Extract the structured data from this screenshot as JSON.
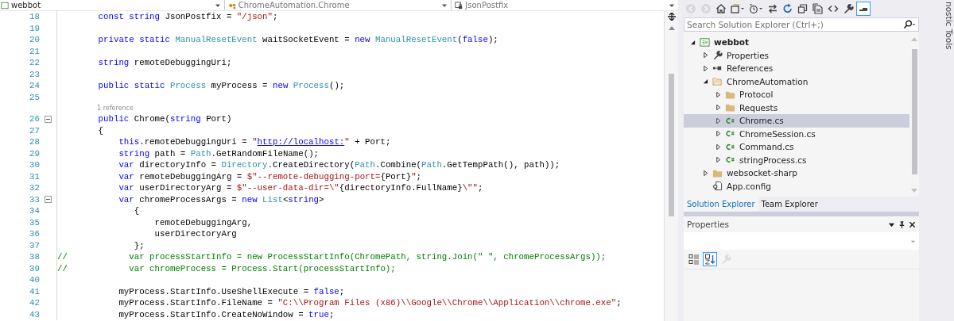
{
  "navigation_bar": [
    {
      "kind": "project",
      "label": "webbot"
    },
    {
      "kind": "class",
      "label": "ChromeAutomation.Chrome"
    },
    {
      "kind": "field",
      "label": "JsonPostfix"
    }
  ],
  "editor": {
    "lines": [
      {
        "kind": "code",
        "number": "18",
        "fold": false,
        "segments": [
          {
            "kind": "kw",
            "t": "        const string "
          },
          {
            "kind": "plain",
            "t": "JsonPostfix = "
          },
          {
            "kind": "str",
            "t": "\"/json\""
          },
          {
            "kind": "plain",
            "t": ";"
          }
        ]
      },
      {
        "kind": "code",
        "number": "19",
        "fold": false
      },
      {
        "kind": "code",
        "number": "20",
        "fold": false,
        "segments": [
          {
            "kind": "kw",
            "t": "        private static "
          },
          {
            "kind": "type",
            "t": "ManualResetEvent"
          },
          {
            "kind": "plain",
            "t": " waitSocketEvent = "
          },
          {
            "kind": "kw",
            "t": "new "
          },
          {
            "kind": "type",
            "t": "ManualResetEvent"
          },
          {
            "kind": "plain",
            "t": "("
          },
          {
            "kind": "kw",
            "t": "false"
          },
          {
            "kind": "plain",
            "t": ");"
          }
        ]
      },
      {
        "kind": "code",
        "number": "21",
        "fold": false
      },
      {
        "kind": "code",
        "number": "22",
        "fold": false,
        "segments": [
          {
            "kind": "kw",
            "t": "        string "
          },
          {
            "kind": "plain",
            "t": "remoteDebuggingUri;"
          }
        ]
      },
      {
        "kind": "code",
        "number": "23",
        "fold": false
      },
      {
        "kind": "code",
        "number": "24",
        "fold": false,
        "segments": [
          {
            "kind": "kw",
            "t": "        public static "
          },
          {
            "kind": "type",
            "t": "Process"
          },
          {
            "kind": "plain",
            "t": " myProcess = "
          },
          {
            "kind": "kw",
            "t": "new "
          },
          {
            "kind": "type",
            "t": "Process"
          },
          {
            "kind": "plain",
            "t": "();"
          }
        ]
      },
      {
        "kind": "code",
        "number": "25",
        "fold": false
      },
      {
        "kind": "codelens",
        "text": "1 reference"
      },
      {
        "kind": "code",
        "number": "26",
        "fold": true,
        "segments": [
          {
            "kind": "kw",
            "t": "        public "
          },
          {
            "kind": "plain",
            "t": "Chrome("
          },
          {
            "kind": "kw",
            "t": "string "
          },
          {
            "kind": "plain",
            "t": "Port)"
          }
        ]
      },
      {
        "kind": "code",
        "number": "27",
        "fold": false,
        "segments": [
          {
            "kind": "plain",
            "t": "        {"
          }
        ]
      },
      {
        "kind": "code",
        "number": "28",
        "fold": false,
        "segments": [
          {
            "kind": "kw",
            "t": "            this"
          },
          {
            "kind": "plain",
            "t": ".remoteDebuggingUri = "
          },
          {
            "kind": "str",
            "t": "\""
          },
          {
            "kind": "link",
            "t": "http://localhost:"
          },
          {
            "kind": "str",
            "t": "\""
          },
          {
            "kind": "plain",
            "t": " + Port;"
          }
        ]
      },
      {
        "kind": "code",
        "number": "29",
        "fold": false,
        "segments": [
          {
            "kind": "kw",
            "t": "            string "
          },
          {
            "kind": "plain",
            "t": "path = "
          },
          {
            "kind": "type",
            "t": "Path"
          },
          {
            "kind": "plain",
            "t": ".GetRandomFileName();"
          }
        ]
      },
      {
        "kind": "code",
        "number": "30",
        "fold": false,
        "segments": [
          {
            "kind": "kw",
            "t": "            var "
          },
          {
            "kind": "plain",
            "t": "directoryInfo = "
          },
          {
            "kind": "type",
            "t": "Directory"
          },
          {
            "kind": "plain",
            "t": ".CreateDirectory("
          },
          {
            "kind": "type",
            "t": "Path"
          },
          {
            "kind": "plain",
            "t": ".Combine("
          },
          {
            "kind": "type",
            "t": "Path"
          },
          {
            "kind": "plain",
            "t": ".GetTempPath(), path));"
          }
        ]
      },
      {
        "kind": "code",
        "number": "31",
        "fold": false,
        "segments": [
          {
            "kind": "kw",
            "t": "            var "
          },
          {
            "kind": "plain",
            "t": "remoteDebuggingArg = "
          },
          {
            "kind": "str",
            "t": "$\"--remote-debugging-port="
          },
          {
            "kind": "plain",
            "t": "{Port}"
          },
          {
            "kind": "str",
            "t": "\""
          },
          {
            "kind": "plain",
            "t": ";"
          }
        ]
      },
      {
        "kind": "code",
        "number": "32",
        "fold": false,
        "segments": [
          {
            "kind": "kw",
            "t": "            var "
          },
          {
            "kind": "plain",
            "t": "userDirectoryArg = "
          },
          {
            "kind": "str",
            "t": "$\"--user-data-dir=\\\""
          },
          {
            "kind": "plain",
            "t": "{directoryInfo.FullName}"
          },
          {
            "kind": "str",
            "t": "\\\"\""
          },
          {
            "kind": "plain",
            "t": ";"
          }
        ]
      },
      {
        "kind": "code",
        "number": "33",
        "fold": true,
        "segments": [
          {
            "kind": "kw",
            "t": "            var "
          },
          {
            "kind": "plain",
            "t": "chromeProcessArgs = "
          },
          {
            "kind": "kw",
            "t": "new "
          },
          {
            "kind": "type",
            "t": "List"
          },
          {
            "kind": "plain",
            "t": "<"
          },
          {
            "kind": "kw",
            "t": "string"
          },
          {
            "kind": "plain",
            "t": ">"
          }
        ]
      },
      {
        "kind": "code",
        "number": "34",
        "fold": false,
        "segments": [
          {
            "kind": "plain",
            "t": "               {"
          }
        ]
      },
      {
        "kind": "code",
        "number": "35",
        "fold": false,
        "segments": [
          {
            "kind": "plain",
            "t": "                   remoteDebuggingArg,"
          }
        ]
      },
      {
        "kind": "code",
        "number": "36",
        "fold": false,
        "segments": [
          {
            "kind": "plain",
            "t": "                   userDirectoryArg"
          }
        ]
      },
      {
        "kind": "code",
        "number": "37",
        "fold": false,
        "segments": [
          {
            "kind": "plain",
            "t": "               };"
          }
        ]
      },
      {
        "kind": "code",
        "number": "38",
        "fold": false,
        "segments": [
          {
            "kind": "comment",
            "t": "//            var processStartInfo = new ProcessStartInfo(ChromePath, string.Join(\" \", chromeProcessArgs));"
          }
        ]
      },
      {
        "kind": "code",
        "number": "39",
        "fold": false,
        "segments": [
          {
            "kind": "comment",
            "t": "//            var chromeProcess = Process.Start(processStartInfo);"
          }
        ]
      },
      {
        "kind": "code",
        "number": "40",
        "fold": false
      },
      {
        "kind": "code",
        "number": "41",
        "fold": false,
        "segments": [
          {
            "kind": "plain",
            "t": "            myProcess.StartInfo.UseShellExecute = "
          },
          {
            "kind": "kw",
            "t": "false"
          },
          {
            "kind": "plain",
            "t": ";"
          }
        ]
      },
      {
        "kind": "code",
        "number": "42",
        "fold": false,
        "segments": [
          {
            "kind": "plain",
            "t": "            myProcess.StartInfo.FileName = "
          },
          {
            "kind": "str",
            "t": "\"C:\\\\Program Files (x86)\\\\Google\\\\Chrome\\\\Application\\\\chrome.exe\""
          },
          {
            "kind": "plain",
            "t": ";"
          }
        ]
      },
      {
        "kind": "code",
        "number": "43",
        "fold": false,
        "segments": [
          {
            "kind": "plain",
            "t": "            myProcess.StartInfo.CreateNoWindow = "
          },
          {
            "kind": "kw",
            "t": "true"
          },
          {
            "kind": "plain",
            "t": ";"
          }
        ]
      }
    ]
  },
  "solution_explorer": {
    "toolbar": [
      {
        "kind": "back",
        "disabled": true,
        "selected": false
      },
      {
        "kind": "forward",
        "disabled": true,
        "selected": false
      },
      {
        "kind": "home",
        "disabled": false,
        "selected": false
      },
      {
        "kind": "switch_views",
        "disabled": false,
        "selected": false
      },
      {
        "kind": "pending_changes",
        "disabled": false,
        "selected": false
      },
      {
        "kind": "sync",
        "disabled": false,
        "selected": false
      },
      {
        "kind": "refresh",
        "disabled": false,
        "selected": false
      },
      {
        "kind": "collapse",
        "disabled": false,
        "selected": false
      },
      {
        "kind": "show_all",
        "disabled": false,
        "selected": false
      },
      {
        "kind": "view_code",
        "disabled": false,
        "selected": false
      },
      {
        "kind": "properties",
        "disabled": false,
        "selected": false
      },
      {
        "kind": "preview",
        "disabled": false,
        "selected": true
      }
    ],
    "search": {
      "placeholder": "Search Solution Explorer (Ctrl+;)"
    },
    "tree": [
      {
        "kind": "project",
        "label": "webbot",
        "expandable": true,
        "expanded": true,
        "selected": false,
        "children": [
          {
            "kind": "properties",
            "label": "Properties",
            "expandable": true,
            "expanded": false,
            "selected": false
          },
          {
            "kind": "references",
            "label": "References",
            "expandable": true,
            "expanded": false,
            "selected": false
          },
          {
            "kind": "folder_open",
            "label": "ChromeAutomation",
            "expandable": true,
            "expanded": true,
            "selected": false,
            "children": [
              {
                "kind": "folder",
                "label": "Protocol",
                "expandable": true,
                "expanded": false,
                "selected": false
              },
              {
                "kind": "folder",
                "label": "Requests",
                "expandable": true,
                "expanded": false,
                "selected": false
              },
              {
                "kind": "cs",
                "label": "Chrome.cs",
                "expandable": true,
                "expanded": false,
                "selected": true
              },
              {
                "kind": "cs",
                "label": "ChromeSession.cs",
                "expandable": true,
                "expanded": false,
                "selected": false
              },
              {
                "kind": "cs",
                "label": "Command.cs",
                "expandable": true,
                "expanded": false,
                "selected": false
              },
              {
                "kind": "cs",
                "label": "stringProcess.cs",
                "expandable": true,
                "expanded": false,
                "selected": false
              }
            ]
          },
          {
            "kind": "folder",
            "label": "websocket-sharp",
            "expandable": true,
            "expanded": false,
            "selected": false
          },
          {
            "kind": "config",
            "label": "App.config",
            "expandable": false,
            "selected": false
          }
        ]
      }
    ],
    "tabs": [
      {
        "label": "Solution Explorer",
        "selected": true
      },
      {
        "label": "Team Explorer",
        "selected": false
      }
    ]
  },
  "properties": {
    "title": "Properties",
    "toolbar": [
      {
        "kind": "categorized",
        "selected": false,
        "disabled": false
      },
      {
        "kind": "alphabetical",
        "selected": true,
        "disabled": false
      },
      {
        "kind": "property_pages",
        "selected": false,
        "disabled": true
      }
    ]
  },
  "side_tab": {
    "label": "nostic Tools"
  }
}
